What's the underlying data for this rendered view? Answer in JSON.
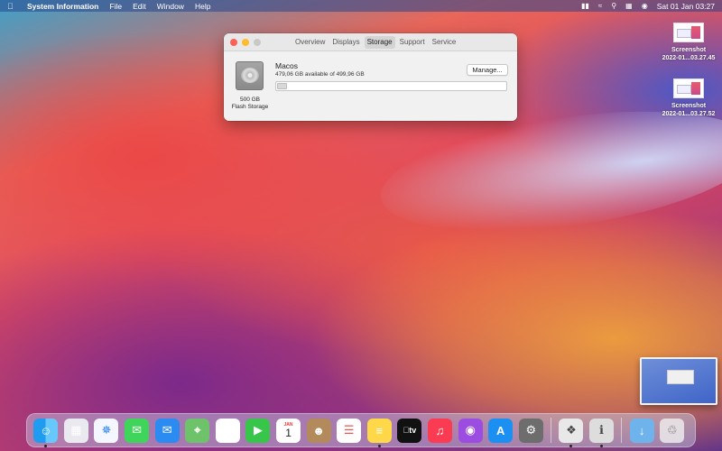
{
  "menubar": {
    "app_name": "System Information",
    "menus": [
      "File",
      "Edit",
      "Window",
      "Help"
    ],
    "clock": "Sat 01 Jan  03:27"
  },
  "desktop": {
    "files": [
      {
        "name_line1": "Screenshot",
        "name_line2": "2022-01...03.27.45"
      },
      {
        "name_line1": "Screenshot",
        "name_line2": "2022-01...03.27.52"
      }
    ]
  },
  "window": {
    "tabs": [
      "Overview",
      "Displays",
      "Storage",
      "Support",
      "Service"
    ],
    "active_tab": "Storage",
    "disk": {
      "size_label": "500 GB",
      "type_label": "Flash Storage",
      "volume_name": "Macos",
      "availability": "479,06 GB available of 499,96 GB",
      "manage_label": "Manage...",
      "used_fraction": 0.042
    }
  },
  "dock": {
    "apps": [
      {
        "name": "Finder",
        "icon": "finder-icon",
        "running": true
      },
      {
        "name": "Launchpad",
        "icon": "launchpad-icon",
        "running": false
      },
      {
        "name": "Safari",
        "icon": "safari-icon",
        "running": false
      },
      {
        "name": "Messages",
        "icon": "messages-icon",
        "running": false
      },
      {
        "name": "Mail",
        "icon": "mail-icon",
        "running": false
      },
      {
        "name": "Maps",
        "icon": "maps-icon",
        "running": false
      },
      {
        "name": "Photos",
        "icon": "photos-icon",
        "running": false
      },
      {
        "name": "FaceTime",
        "icon": "facetime-icon",
        "running": false
      },
      {
        "name": "Calendar",
        "icon": "calendar-icon",
        "running": false,
        "month": "JAN",
        "day": "1"
      },
      {
        "name": "Contacts",
        "icon": "contacts-icon",
        "running": false
      },
      {
        "name": "Reminders",
        "icon": "reminders-icon",
        "running": false
      },
      {
        "name": "Notes",
        "icon": "notes-icon",
        "running": true
      },
      {
        "name": "Apple TV",
        "icon": "appletv-icon",
        "running": false,
        "label": "tv"
      },
      {
        "name": "Music",
        "icon": "music-icon",
        "running": false
      },
      {
        "name": "Podcasts",
        "icon": "podcasts-icon",
        "running": false
      },
      {
        "name": "App Store",
        "icon": "appstore-icon",
        "running": false
      },
      {
        "name": "System Preferences",
        "icon": "gear-icon",
        "running": false
      },
      {
        "name": "Preview",
        "icon": "preview-icon",
        "running": true
      },
      {
        "name": "System Information",
        "icon": "system-information-icon",
        "running": true
      },
      {
        "name": "Downloads",
        "icon": "downloads-folder-icon",
        "running": false
      },
      {
        "name": "Trash",
        "icon": "trash-icon",
        "running": false
      }
    ]
  },
  "colors": {
    "close": "#fe5f57",
    "minimize": "#febc2e",
    "maximize_disabled": "#c8c8c8"
  }
}
